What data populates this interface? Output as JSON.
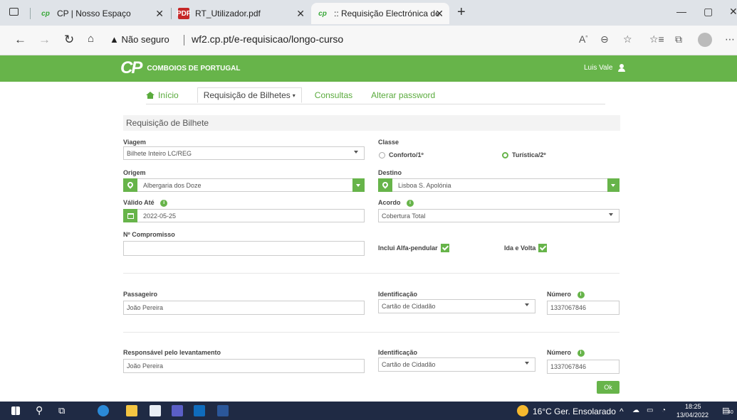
{
  "browser": {
    "tabs": [
      {
        "label": "CP | Nosso Espaço",
        "icon": "cp-logo-icon"
      },
      {
        "label": "RT_Utilizador.pdf",
        "icon": "pdf-icon"
      },
      {
        "label": ":: Requisição Electrónica de Trans",
        "icon": "cp-logo-icon",
        "active": true
      }
    ],
    "new_tab": "+",
    "security_label": "Não seguro",
    "url": "wf2.cp.pt/e-requisicao/longo-curso"
  },
  "header": {
    "logo_mark": "CP",
    "logo_text": "COMBOIOS DE PORTUGAL",
    "user_name": "Luis Vale"
  },
  "menu": {
    "home": "Início",
    "requests": "Requisição de Bilhetes",
    "queries": "Consultas",
    "password": "Alterar password"
  },
  "form": {
    "section_title": "Requisição de Bilhete",
    "viagem_label": "Viagem",
    "viagem_value": "Bilhete Inteiro LC/REG",
    "classe_label": "Classe",
    "classe_opt1": "Conforto/1º",
    "classe_opt2": "Turística/2º",
    "classe_selected": "Turística/2º",
    "origem_label": "Origem",
    "origem_value": "Albergaria dos Doze",
    "destino_label": "Destino",
    "destino_value": "Lisboa S. Apolónia",
    "valido_label": "Válido Até",
    "valido_value": "2022-05-25",
    "acordo_label": "Acordo",
    "acordo_value": "Cobertura Total",
    "compromisso_label": "Nº Compromisso",
    "compromisso_value": "",
    "alfa_label": "Inclui Alfa-pendular",
    "alfa_checked": true,
    "idavolta_label": "Ida e Volta",
    "idavolta_checked": true,
    "passageiro_label": "Passageiro",
    "passageiro_value": "João Pereira",
    "ident1_label": "Identificação",
    "ident1_value": "Cartão de Cidadão",
    "numero1_label": "Número",
    "numero1_value": "1337067846",
    "responsavel_label": "Responsável pelo levantamento",
    "responsavel_value": "João Pereira",
    "ident2_label": "Identificação",
    "ident2_value": "Cartão de Cidadão",
    "numero2_label": "Número",
    "numero2_value": "1337067846",
    "ok_label": "Ok"
  },
  "taskbar": {
    "weather": "16°C Ger. Ensolarado",
    "time": "18:25",
    "date": "13/04/2022",
    "notif_count": "40"
  },
  "colors": {
    "brand_green": "#67b44a",
    "link_green": "#5aab3d",
    "taskbar": "#1f2a44"
  }
}
